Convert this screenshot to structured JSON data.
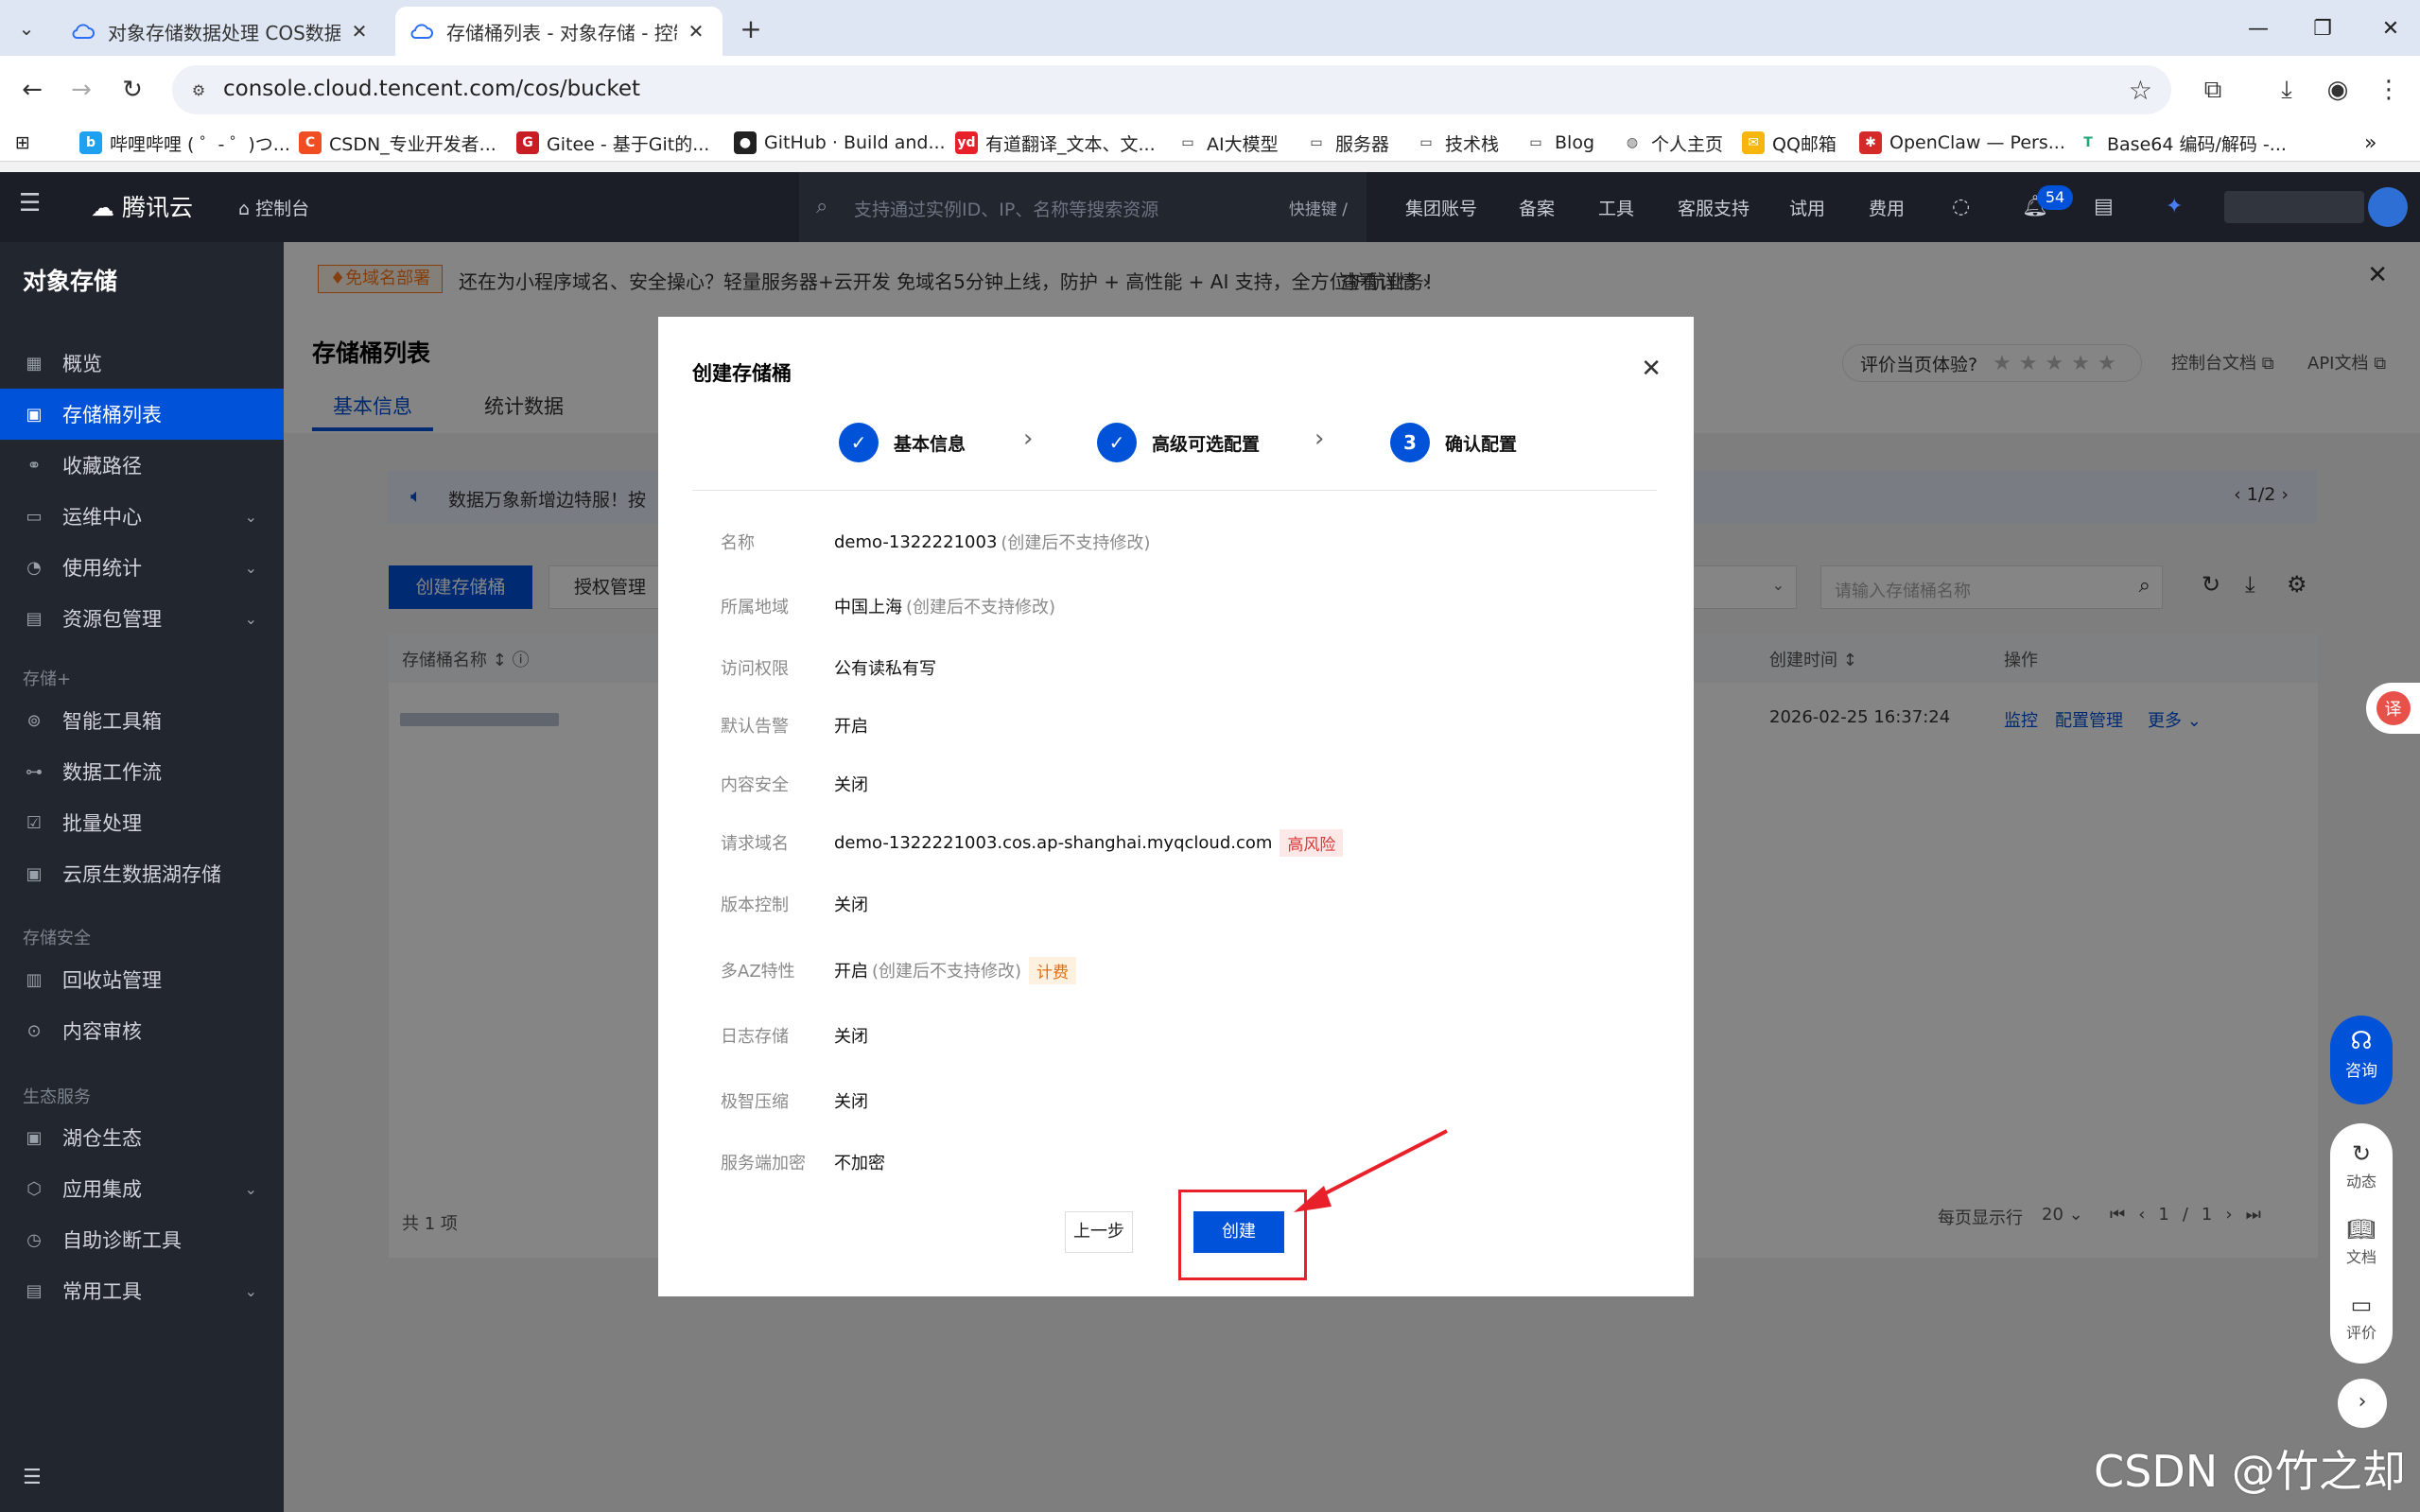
{
  "browser": {
    "tabs": [
      {
        "title": "对象存储数据处理 COS数据处",
        "active": false
      },
      {
        "title": "存储桶列表 - 对象存储 - 控制台",
        "active": true
      }
    ],
    "url": "console.cloud.tencent.com/cos/bucket",
    "bookmarks": [
      {
        "label": "哔哩哔哩 ( ゜- ゜)つ...",
        "icon": "bilibili-icon"
      },
      {
        "label": "CSDN_专业开发者...",
        "icon": "csdn-icon"
      },
      {
        "label": "Gitee - 基于Git的...",
        "icon": "gitee-icon"
      },
      {
        "label": "GitHub · Build and...",
        "icon": "github-icon"
      },
      {
        "label": "有道翻译_文本、文...",
        "icon": "youdao-icon"
      },
      {
        "label": "AI大模型",
        "icon": "folder-icon"
      },
      {
        "label": "服务器",
        "icon": "folder-icon"
      },
      {
        "label": "技术栈",
        "icon": "folder-icon"
      },
      {
        "label": "Blog",
        "icon": "folder-icon"
      },
      {
        "label": "个人主页",
        "icon": "globe-icon"
      },
      {
        "label": "QQ邮箱",
        "icon": "qqmail-icon"
      },
      {
        "label": "OpenClaw — Pers...",
        "icon": "openclaw-icon"
      },
      {
        "label": "Base64 编码/解码 -...",
        "icon": "base64-icon"
      }
    ]
  },
  "console": {
    "brand": "腾讯云",
    "home": "控制台",
    "search_placeholder": "支持通过实例ID、IP、名称等搜索资源",
    "shortcut": "快捷键 /",
    "nav": [
      "集团账号",
      "备案",
      "工具",
      "客服支持",
      "试用",
      "费用"
    ],
    "notification_count": "54"
  },
  "sidebar": {
    "title": "对象存储",
    "items": [
      {
        "label": "概览",
        "icon": "grid-icon",
        "active": false
      },
      {
        "label": "存储桶列表",
        "icon": "bucket-icon",
        "active": true
      },
      {
        "label": "收藏路径",
        "icon": "link-icon",
        "active": false
      },
      {
        "label": "运维中心",
        "icon": "monitor-icon",
        "active": false,
        "expandable": true
      },
      {
        "label": "使用统计",
        "icon": "pie-icon",
        "active": false,
        "expandable": true
      },
      {
        "label": "资源包管理",
        "icon": "package-icon",
        "active": false,
        "expandable": true
      }
    ],
    "group_storage_plus": "存储+",
    "items2": [
      {
        "label": "智能工具箱",
        "icon": "toolbox-icon"
      },
      {
        "label": "数据工作流",
        "icon": "workflow-icon"
      },
      {
        "label": "批量处理",
        "icon": "batch-icon"
      },
      {
        "label": "云原生数据湖存储",
        "icon": "datalake-icon"
      }
    ],
    "group_security": "存储安全",
    "items3": [
      {
        "label": "回收站管理",
        "icon": "trash-icon"
      },
      {
        "label": "内容审核",
        "icon": "audit-icon"
      }
    ],
    "group_ecosystem": "生态服务",
    "items4": [
      {
        "label": "湖仓生态",
        "icon": "lakehouse-icon"
      },
      {
        "label": "应用集成",
        "icon": "integration-icon",
        "expandable": true
      },
      {
        "label": "自助诊断工具",
        "icon": "diagnose-icon"
      },
      {
        "label": "常用工具",
        "icon": "tools-icon",
        "expandable": true
      }
    ]
  },
  "promo": {
    "tag": "♦免域名部署",
    "text": "还在为小程序域名、安全操心？轻量服务器+云开发 免域名5分钟上线，防护 + 高性能 + AI 支持，全方位护航业务！",
    "more": "查看详情 ›"
  },
  "page": {
    "title": "存储桶列表",
    "tabs": [
      "基本信息",
      "统计数据"
    ],
    "rate_label": "评价当页体验?",
    "links": [
      "控制台文档",
      "API文档"
    ],
    "notice": "数据万象新增边特服！按",
    "notice_pager": "1/2",
    "create_button": "创建存储桶",
    "auth_button": "授权管理",
    "search_placeholder": "请输入存储桶名称",
    "columns": [
      "存储桶名称",
      "创建时间",
      "操作"
    ],
    "row": {
      "created": "2026-02-25 16:37:24",
      "actions": [
        "监控",
        "配置管理",
        "更多"
      ]
    },
    "total": "共 1 项",
    "page_size_label": "每页显示行",
    "page_size": "20",
    "page_index": "1/1"
  },
  "modal": {
    "title": "创建存储桶",
    "steps": [
      {
        "label": "基本信息",
        "state": "done",
        "mark": "✓"
      },
      {
        "label": "高级可选配置",
        "state": "done",
        "mark": "✓"
      },
      {
        "label": "确认配置",
        "state": "current",
        "mark": "3"
      }
    ],
    "fields": [
      {
        "key": "名称",
        "value": "demo-1322221003",
        "note": "(创建后不支持修改)"
      },
      {
        "key": "所属地域",
        "value": "中国上海",
        "note": "(创建后不支持修改)"
      },
      {
        "key": "访问权限",
        "value": "公有读私有写"
      },
      {
        "key": "默认告警",
        "value": "开启"
      },
      {
        "key": "内容安全",
        "value": "关闭"
      },
      {
        "key": "请求域名",
        "value": "demo-1322221003.cos.ap-shanghai.myqcloud.com",
        "tag": "高风险"
      },
      {
        "key": "版本控制",
        "value": "关闭"
      },
      {
        "key": "多AZ特性",
        "value": "开启",
        "note": "(创建后不支持修改)",
        "tag": "计费"
      },
      {
        "key": "日志存储",
        "value": "关闭"
      },
      {
        "key": "极智压缩",
        "value": "关闭"
      },
      {
        "key": "服务端加密",
        "value": "不加密"
      }
    ],
    "prev_button": "上一步",
    "create_button": "创建"
  },
  "floating": {
    "consult": "咨询",
    "items": [
      "动态",
      "文档",
      "评价"
    ],
    "translate": "译"
  },
  "watermark": "CSDN @竹之却"
}
